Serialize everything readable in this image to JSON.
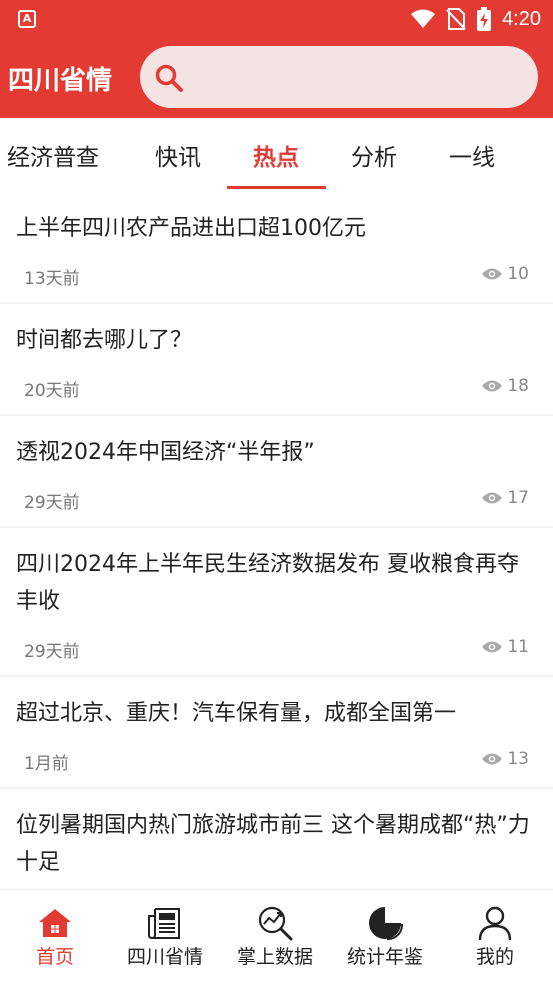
{
  "status_bar": {
    "time": "4:20",
    "app_icon_letter": "A"
  },
  "header": {
    "title": "四川省情",
    "search": {
      "placeholder": "",
      "value": ""
    }
  },
  "tabs": [
    {
      "label": "经济普查",
      "active": false
    },
    {
      "label": "快讯",
      "active": false
    },
    {
      "label": "热点",
      "active": true
    },
    {
      "label": "分析",
      "active": false
    },
    {
      "label": "一线",
      "active": false
    }
  ],
  "articles": [
    {
      "title": "上半年四川农产品进出口超100亿元",
      "time": "13天前",
      "views": "10"
    },
    {
      "title": "时间都去哪儿了？",
      "time": "20天前",
      "views": "18"
    },
    {
      "title": "透视2024年中国经济“半年报”",
      "time": "29天前",
      "views": "17"
    },
    {
      "title": "四川2024年上半年民生经济数据发布 夏收粮食再夺丰收",
      "time": "29天前",
      "views": "11"
    },
    {
      "title": "超过北京、重庆！汽车保有量，成都全国第一",
      "time": "1月前",
      "views": "13"
    },
    {
      "title": "位列暑期国内热门旅游城市前三 这个暑期成都“热”力十足",
      "time": "",
      "views": ""
    }
  ],
  "bottom_nav": [
    {
      "label": "首页",
      "icon": "home-icon",
      "active": true
    },
    {
      "label": "四川省情",
      "icon": "newspaper-icon",
      "active": false
    },
    {
      "label": "掌上数据",
      "icon": "chart-search-icon",
      "active": false
    },
    {
      "label": "统计年鉴",
      "icon": "pie-chart-icon",
      "active": false
    },
    {
      "label": "我的",
      "icon": "user-icon",
      "active": false
    }
  ],
  "colors": {
    "primary": "#e33b34",
    "search_bg": "#f3e4e3",
    "meta_text": "#777777"
  }
}
